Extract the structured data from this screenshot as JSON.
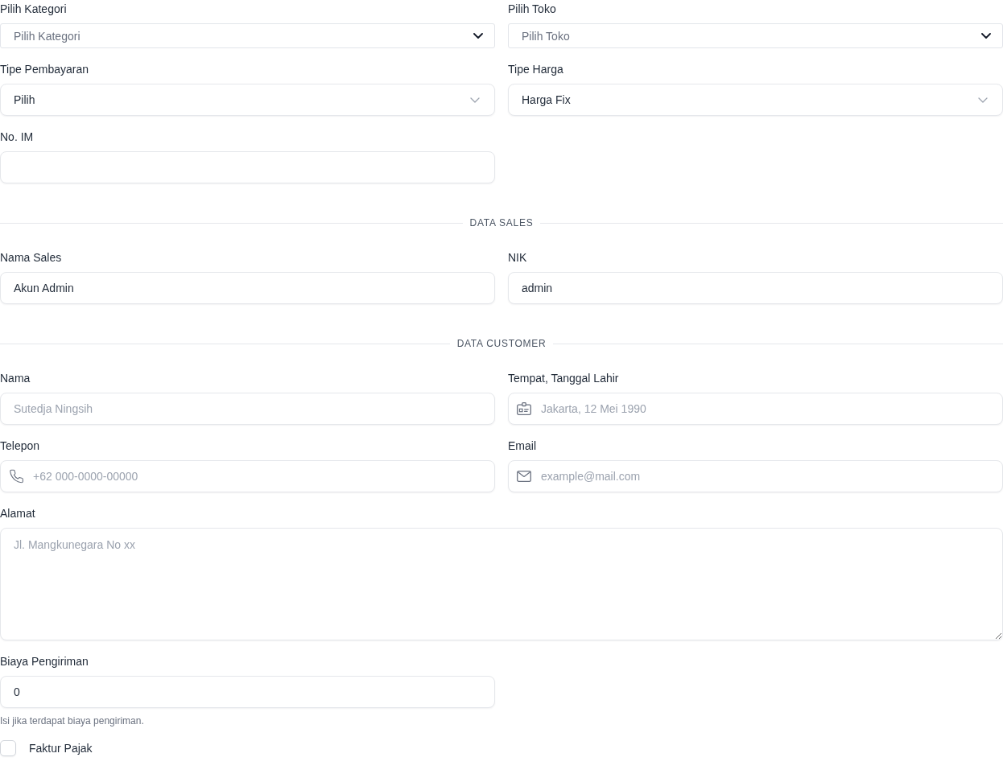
{
  "sections": [
    {
      "fields": [
        {
          "kind": "combobox",
          "label": "Pilih Kategori",
          "placeholder": "Pilih Kategori"
        },
        {
          "kind": "combobox",
          "label": "Pilih Toko",
          "placeholder": "Pilih Toko"
        },
        {
          "kind": "select",
          "label": "Tipe Pembayaran",
          "value": "Pilih"
        },
        {
          "kind": "select",
          "label": "Tipe Harga",
          "value": "Harga Fix"
        },
        {
          "kind": "text",
          "label": "No. IM"
        }
      ]
    },
    {
      "title": "DATA SALES",
      "fields": [
        {
          "kind": "text",
          "label": "Nama Sales",
          "value": "Akun Admin"
        },
        {
          "kind": "text",
          "label": "NIK",
          "value": "admin"
        }
      ]
    },
    {
      "title": "DATA CUSTOMER",
      "fields": [
        {
          "kind": "text",
          "label": "Nama",
          "placeholder": "Sutedja Ningsih"
        },
        {
          "kind": "identity",
          "label": "Tempat, Tanggal Lahir",
          "placeholder": "Jakarta, 12 Mei 1990"
        },
        {
          "kind": "tel",
          "label": "Telepon",
          "placeholder": "+62 000-0000-00000"
        },
        {
          "kind": "email",
          "label": "Email",
          "placeholder": "example@mail.com"
        },
        {
          "kind": "textarea",
          "label": "Alamat",
          "placeholder": "Jl. Mangkunegara No xx"
        },
        {
          "kind": "text",
          "label": "Biaya Pengiriman",
          "value": "0",
          "help": "Isi jika terdapat biaya pengiriman."
        },
        {
          "kind": "checkbox",
          "label": "Faktur Pajak",
          "checked": false
        }
      ]
    }
  ]
}
